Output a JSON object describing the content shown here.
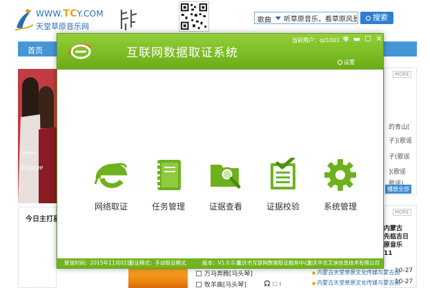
{
  "site": {
    "logo_url_pre": "WWW.",
    "logo_url_mark": "TC",
    "logo_url_post": "Y.COM",
    "logo_name": "天堂草原音乐网",
    "search_category": "歌曲",
    "search_value": "听草原音乐，看草原风景",
    "search_button": "搜索",
    "nav_home": "首页",
    "today_title": "今日主打星",
    "right_lines": [
      "的青山[",
      "子](歌谣",
      "子(歌谣",
      "](歌谣",
      "歌谣)"
    ],
    "play_all": "播放全部",
    "more_label": "MORE",
    "news_title_lines": [
      "内蒙古",
      "先临吉日",
      "原音乐",
      "11"
    ],
    "dates": [
      "10-27",
      "10-27"
    ],
    "songs": [
      "万马奔腾[马头琴]",
      "牧羊曲[马头琴]"
    ],
    "news": [
      "内蒙古天堂草原文化传媒与蒙古国",
      "内蒙古天堂草原文化传媒与蒙古国"
    ]
  },
  "dialog": {
    "title": "互联网数据取证系统",
    "current_user": "当前用户：qz1001",
    "settings_label": "设置",
    "window_buttons": [
      "min",
      "max",
      "close"
    ],
    "tiles": [
      {
        "id": "network",
        "label": "网络取证",
        "icon": "ie-network-icon"
      },
      {
        "id": "tasks",
        "label": "任务管理",
        "icon": "notebook-icon"
      },
      {
        "id": "evidence",
        "label": "证据查看",
        "icon": "folder-search-icon"
      },
      {
        "id": "verify",
        "label": "证据校验",
        "icon": "checklist-icon"
      },
      {
        "id": "system",
        "label": "系统管理",
        "icon": "gear-icon"
      }
    ],
    "footer": {
      "login_time": "登录时间：2015年11月02日",
      "mode": "取证模式：手动取证模式",
      "version": "版本：V1.0.0.0",
      "org1": "重庆市互联网数据取证服务中心",
      "org2": "重庆华龙艾迪信息技术有限公司"
    }
  },
  "colors": {
    "header_green": "#7cbc24",
    "footer_green": "#72b41e",
    "icon_green": "#6db21e",
    "nav_blue": "#4596d6"
  }
}
